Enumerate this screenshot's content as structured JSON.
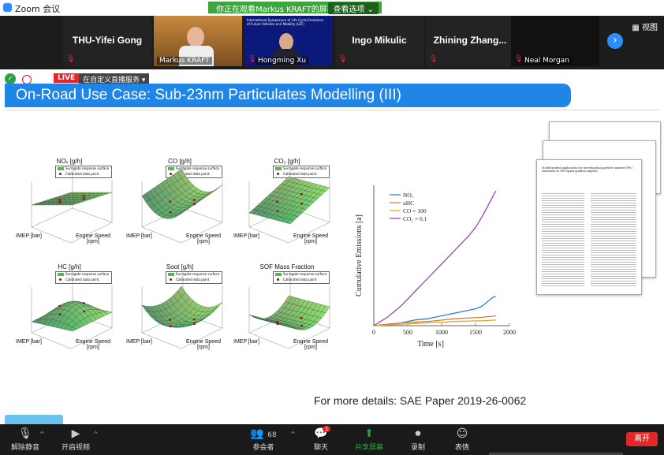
{
  "window": {
    "title": "Zoom 会议"
  },
  "viewing_banner": {
    "text": "你正在观看Markus KRAFT的屏幕",
    "options_label": "查看选项"
  },
  "participants": [
    {
      "name": "THU-Yifei Gong",
      "type": "name"
    },
    {
      "name": "Markus KRAFT",
      "type": "video"
    },
    {
      "name": "Hongming Xu",
      "type": "video"
    },
    {
      "name": "Ingo Mikulic",
      "type": "name"
    },
    {
      "name": "Zhining Zhang...",
      "type": "name"
    },
    {
      "name": "Neal Morgan",
      "type": "video"
    }
  ],
  "video_tile_text": {
    "hongming_line1": "International Symposium of Life Cycle Emissions",
    "hongming_line2": "of Future Vehicles and Mobility (LEF)"
  },
  "view_button": "视图",
  "live": {
    "badge": "LIVE",
    "service": "在自定义直播服务"
  },
  "slide": {
    "title": "On-Road Use Case: Sub-23nm Particulates Modelling (III)",
    "more_details": "For more details: SAE Paper 2019-26-0062",
    "surface_plots": [
      {
        "title": "NOₓ [g/h]",
        "xlabel": "IMEP [bar]",
        "ylabel": "Engine Speed\n[rpm]"
      },
      {
        "title": "CO [g/h]",
        "xlabel": "IMEP [bar]",
        "ylabel": "Engine Speed\n[rpm]"
      },
      {
        "title": "CO₂ [g/h]",
        "xlabel": "IMEP [bar]",
        "ylabel": "Engine Speed\n[rpm]"
      },
      {
        "title": "HC [g/h]",
        "xlabel": "IMEP [bar]",
        "ylabel": "Engine Speed\n[rpm]"
      },
      {
        "title": "Soot [g/h]",
        "xlabel": "IMEP [bar]",
        "ylabel": "Engine Speed\n[rpm]"
      },
      {
        "title": "SOF Mass Fraction",
        "xlabel": "IMEP [bar]",
        "ylabel": "Engine Speed\n[rpm]"
      }
    ],
    "legend_entries": [
      "Surrogate response surface",
      "Calibrated data point"
    ],
    "paper_title": "Model-guided application for investigating particle number (PN) emissions in GDI spark ignition engines"
  },
  "chart_data": {
    "type": "line",
    "xlabel": "Time [s]",
    "ylabel": "Cumulative Emissions [a]",
    "xlim": [
      0,
      2000
    ],
    "ylim": [
      0,
      1
    ],
    "xticks": [
      0,
      500,
      1000,
      1500,
      2000
    ],
    "legend_position": "top-left",
    "series": [
      {
        "name": "NOₓ",
        "color": "#1f77d4",
        "x": [
          0,
          200,
          400,
          600,
          800,
          1000,
          1200,
          1400,
          1500,
          1600,
          1700,
          1750,
          1800
        ],
        "y": [
          0,
          0.01,
          0.02,
          0.04,
          0.05,
          0.07,
          0.09,
          0.11,
          0.12,
          0.14,
          0.18,
          0.2,
          0.21
        ]
      },
      {
        "name": "uHC",
        "color": "#e0701c",
        "x": [
          0,
          400,
          800,
          1200,
          1600,
          1800
        ],
        "y": [
          0,
          0.02,
          0.03,
          0.05,
          0.06,
          0.07
        ]
      },
      {
        "name": "CO × 100",
        "color": "#d8a623",
        "x": [
          0,
          400,
          800,
          1200,
          1600,
          1800
        ],
        "y": [
          0,
          0.01,
          0.02,
          0.03,
          0.035,
          0.04
        ]
      },
      {
        "name": "CO₂ × 0.1",
        "color": "#8a3d9e",
        "x": [
          0,
          200,
          400,
          600,
          800,
          1000,
          1200,
          1400,
          1500,
          1600,
          1700,
          1800
        ],
        "y": [
          0,
          0.06,
          0.14,
          0.24,
          0.34,
          0.44,
          0.54,
          0.64,
          0.7,
          0.78,
          0.87,
          0.96
        ]
      }
    ]
  },
  "toolbar": {
    "mute": "解除静音",
    "video": "开启视频",
    "participants": "参会者",
    "participants_count": "68",
    "chat": "聊天",
    "chat_badge": "1",
    "share": "共享屏幕",
    "record": "录制",
    "reactions": "表情",
    "leave": "离开"
  }
}
